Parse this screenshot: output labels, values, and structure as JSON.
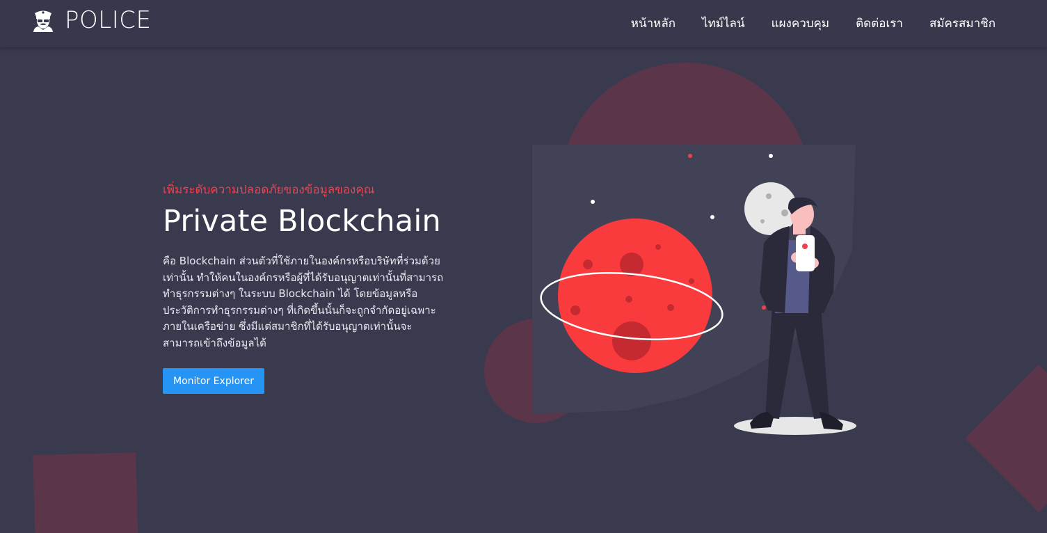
{
  "brand": {
    "name": "POLICE",
    "logo_icon": "police-officer-icon"
  },
  "nav": {
    "items": [
      {
        "label": "หน้าหลัก"
      },
      {
        "label": "ไทม์ไลน์"
      },
      {
        "label": "แผงควบคุม"
      },
      {
        "label": "ติดต่อเรา"
      },
      {
        "label": "สมัครสมาชิก"
      }
    ]
  },
  "hero": {
    "tagline": "เพิ่มระดับความปลอดภัยของข้อมูลของคุณ",
    "headline": "Private Blockchain",
    "description": "คือ Blockchain ส่วนตัวที่ใช้ภายในองค์กรหรือบริษัทที่ร่วมด้วยเท่านั้น ทำให้คนในองค์กรหรือผู้ที่ได้รับอนุญาตเท่านั้นที่สามารถทำธุรกรรมต่างๆ ในระบบ Blockchain ได้ โดยข้อมูลหรือประวัติการทำธุรกรรมต่างๆ ที่เกิดขึ้นนั้นก็จะถูกจำกัดอยู่เฉพาะภายในเครือข่าย ซึ่งมีแต่สมาชิกที่ได้รับอนุญาตเท่านั้นจะสามารถเข้าถึงข้อมูลได้",
    "cta_label": "Monitor Explorer"
  },
  "colors": {
    "background": "#3a3a4f",
    "header": "#37384c",
    "accent_red": "#f2404d",
    "cta_blue": "#2594f5",
    "deco_maroon": "#5b3549"
  }
}
